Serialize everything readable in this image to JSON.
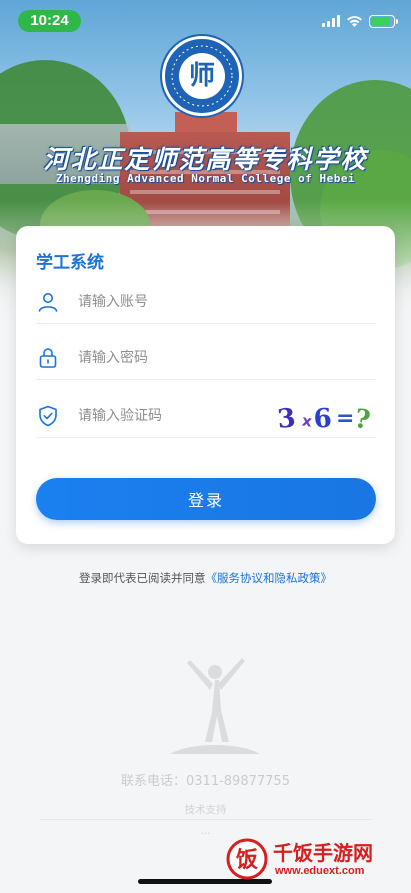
{
  "status_bar": {
    "time": "10:24",
    "battery_level": 0.85
  },
  "header": {
    "logo_char": "师",
    "school_name_cn": "河北正定师范高等专科学校",
    "school_name_en": "Zhengding Advanced Normal College of Hebei"
  },
  "login": {
    "title": "学工系统",
    "account_placeholder": "请输入账号",
    "password_placeholder": "请输入密码",
    "captcha_placeholder": "请输入验证码",
    "captcha_text": "3 x6 =?",
    "submit_label": "登录"
  },
  "agreement": {
    "prefix": "登录即代表已阅读并同意",
    "link": "《服务协议和隐私政策》"
  },
  "footer": {
    "contact": "联系电话：0311-89877755",
    "tech_support": "技术支持",
    "vendor": "..."
  },
  "watermark": {
    "title": "千饭手游网",
    "url": "www.eduext.com"
  },
  "colors": {
    "accent": "#1a73d9",
    "button": "#1976e2",
    "time_pill": "#2fb84a",
    "watermark": "#d81e1e"
  }
}
